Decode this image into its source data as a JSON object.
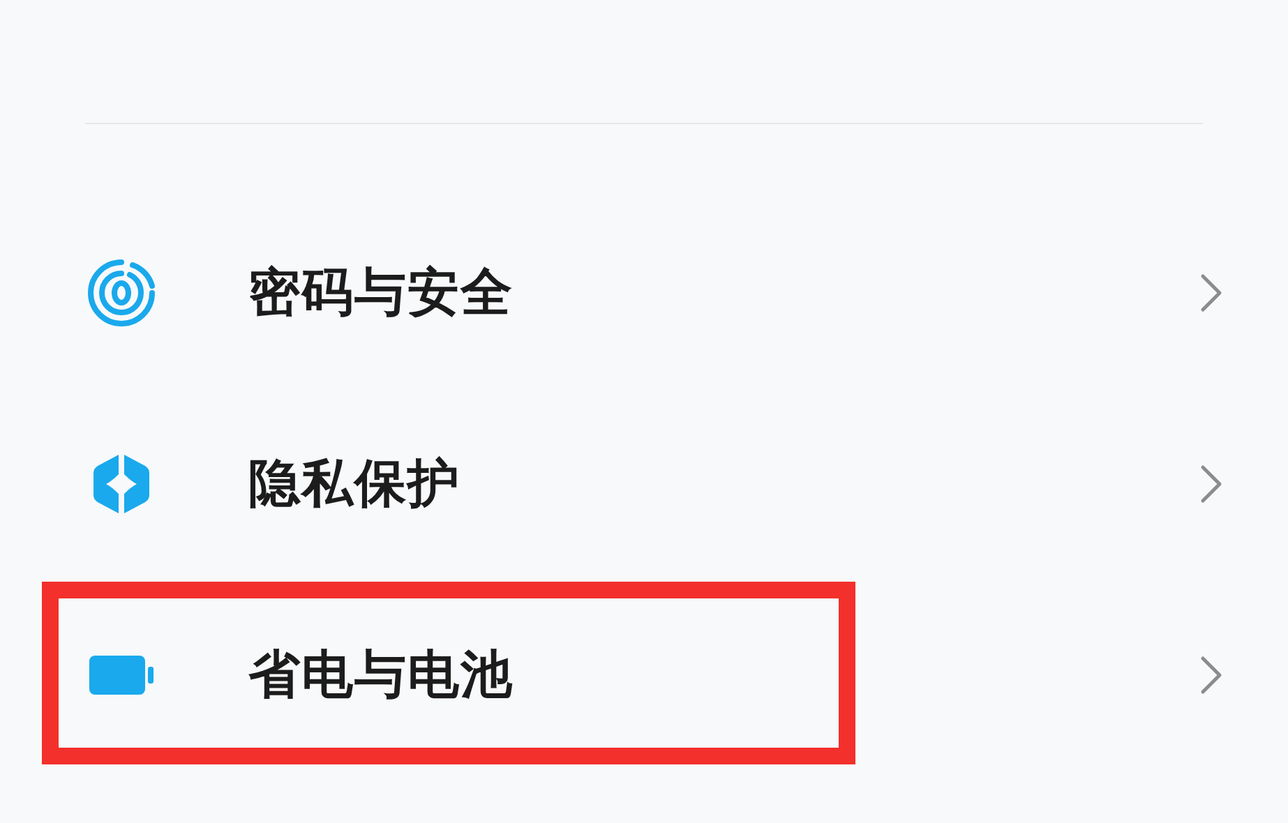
{
  "settings_items": [
    {
      "label": "密码与安全",
      "kind": "security",
      "highlighted": false
    },
    {
      "label": "隐私保护",
      "kind": "privacy",
      "highlighted": false
    },
    {
      "label": "省电与电池",
      "kind": "battery",
      "highlighted": true
    }
  ]
}
